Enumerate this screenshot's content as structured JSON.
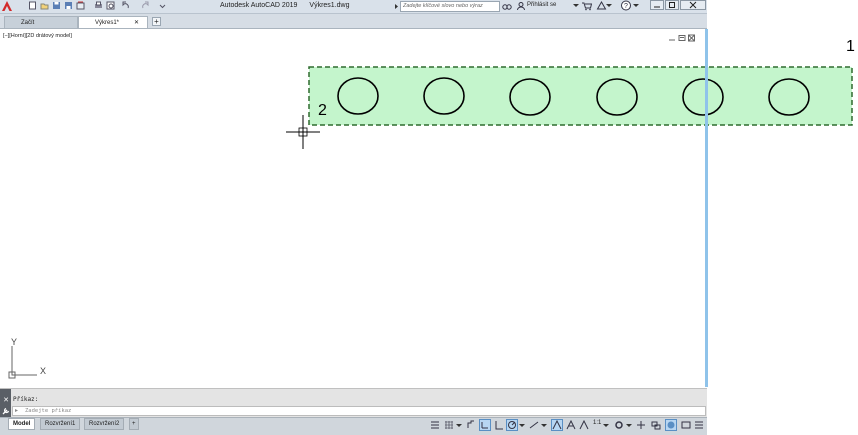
{
  "window": {
    "app_name": "Autodesk AutoCAD 2019",
    "file_name": "Výkres1.dwg",
    "search_placeholder": "Zadejte klíčové slovo nebo výraz",
    "signin_label": "Přihlásit se"
  },
  "tabs": [
    {
      "label": "Začít",
      "active": false
    },
    {
      "label": "Výkres1*",
      "active": true
    }
  ],
  "viewport": {
    "label": "[−][Horní][2D drátový model]",
    "callout_1": "1",
    "callout_2": "2",
    "ucs_x": "X",
    "ucs_y": "Y",
    "selection_fill": "#c4f5cc",
    "selection_border": "#2e6b2e",
    "accent_strip": "#8fc3ea"
  },
  "command_line": {
    "history": "Příkaz:",
    "placeholder": "Zadejte příkaz"
  },
  "layout_tabs": [
    "Model",
    "Rozvržení1",
    "Rozvržení2"
  ],
  "status_bar": {
    "annotation_scale": "1:1"
  },
  "icons": [
    "autocad-logo-icon",
    "new-icon",
    "open-icon",
    "save-icon",
    "saveas-icon",
    "web-icon",
    "plot-icon",
    "undo-icon",
    "redo-icon",
    "binoculars-icon",
    "user-icon",
    "cart-icon",
    "exchange-icon",
    "help-icon",
    "grid-icon",
    "snap-icon",
    "ortho-icon",
    "polar-icon",
    "osnap-icon",
    "annotation-icon",
    "workspace-icon",
    "fullscreen-icon",
    "customize-icon"
  ]
}
